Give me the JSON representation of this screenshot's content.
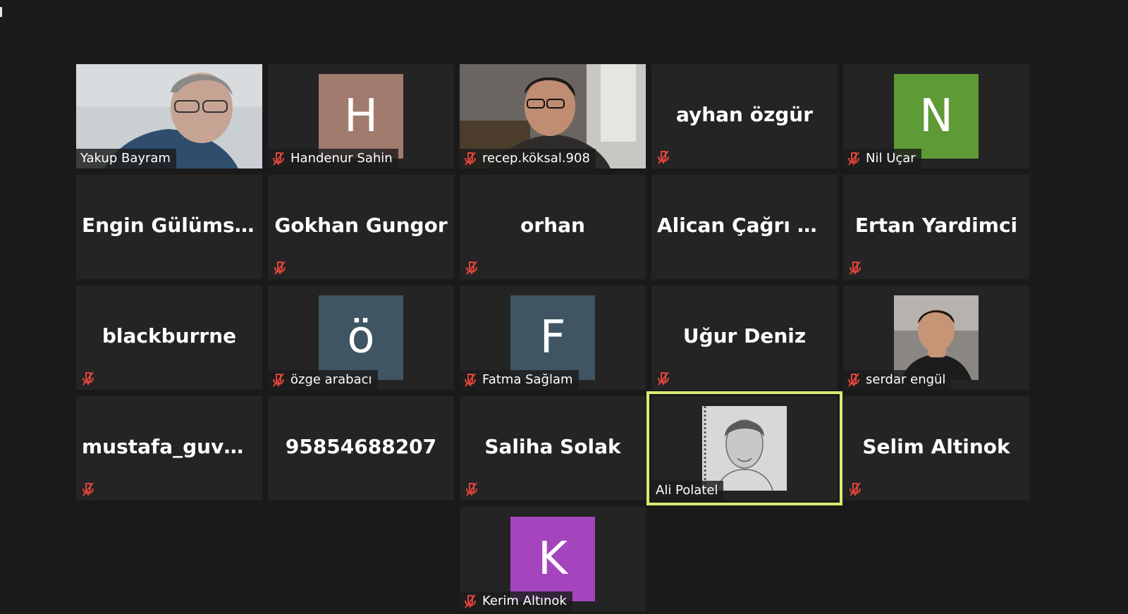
{
  "colors": {
    "background": "#1a1a1a",
    "tile": "#242424",
    "active_speaker_border": "#d9ea6f",
    "muted_icon": "#e0453b"
  },
  "participants": [
    {
      "name": "Yakup Bayram",
      "display": "video",
      "muted": false
    },
    {
      "name": "Handenur Sahin",
      "display": "avatar",
      "initial": "H",
      "avatar_color": "#a07b6e",
      "muted": true
    },
    {
      "name": "recep.köksal.908",
      "display": "video",
      "muted": true
    },
    {
      "name": "ayhan özgür",
      "display": "name",
      "muted": true
    },
    {
      "name": "Nil Uçar",
      "display": "avatar",
      "initial": "N",
      "avatar_color": "#5e9a35",
      "muted": true
    },
    {
      "name": "Engin Gülümser",
      "display": "name",
      "muted": false
    },
    {
      "name": "Gokhan Gungor",
      "display": "name",
      "muted": true
    },
    {
      "name": "orhan",
      "display": "name",
      "muted": true
    },
    {
      "name": "Alican  Çağrı  Gö...",
      "display": "name",
      "muted": false
    },
    {
      "name": "Ertan Yardimci",
      "display": "name",
      "muted": true
    },
    {
      "name": "blackburrne",
      "display": "name",
      "muted": true
    },
    {
      "name": "özge arabacı",
      "display": "avatar",
      "initial": "ö",
      "avatar_color": "#3f5563",
      "muted": true
    },
    {
      "name": "Fatma Sağlam",
      "display": "avatar",
      "initial": "F",
      "avatar_color": "#3f5563",
      "muted": true
    },
    {
      "name": "Uğur Deniz",
      "display": "name",
      "muted": true
    },
    {
      "name": "serdar engül",
      "display": "photo",
      "muted": true
    },
    {
      "name": "mustafa_guvenli",
      "display": "name",
      "muted": true
    },
    {
      "name": "95854688207",
      "display": "name",
      "muted": false
    },
    {
      "name": "Saliha Solak",
      "display": "name",
      "muted": true
    },
    {
      "name": "Ali Polatel",
      "display": "photo",
      "muted": false,
      "active_speaker": true
    },
    {
      "name": "Selim Altinok",
      "display": "name",
      "muted": true
    },
    {
      "name": "Kerim Altınok",
      "display": "avatar",
      "initial": "K",
      "avatar_color": "#a545bd",
      "muted": true
    }
  ]
}
